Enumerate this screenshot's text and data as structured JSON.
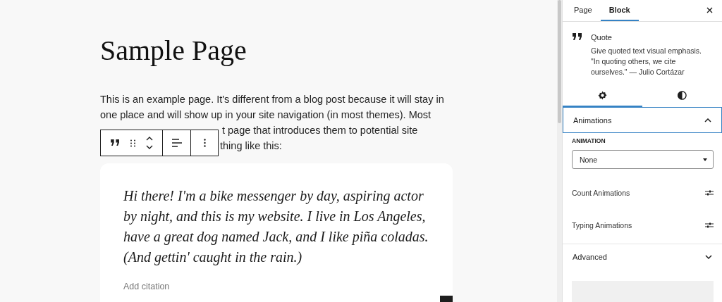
{
  "editor": {
    "title": "Sample Page",
    "paragraph_lines": [
      "This is an example page. It's different from a blog post because it will stay in",
      "one place and will show up in your site navigation (in most themes). Most",
      "t page that introduces them to potential site",
      "thing like this:"
    ],
    "quote": {
      "text": "Hi there! I'm a bike messenger by day, aspiring actor by night, and this is my website. I live in Los Angeles, have a great dog named Jack, and I like piña coladas. (And gettin' caught in the rain.)",
      "citation_placeholder": "Add citation"
    }
  },
  "sidebar": {
    "tabs": [
      {
        "label": "Page",
        "selected": false
      },
      {
        "label": "Block",
        "selected": true
      }
    ],
    "block_card": {
      "title": "Quote",
      "description": "Give quoted text visual emphasis. \"In quoting others, we cite ourselves.\" — Julio Cortázar"
    },
    "icon_tabs": [
      {
        "kind": "settings",
        "selected": true
      },
      {
        "kind": "styles",
        "selected": false
      }
    ],
    "panels": [
      {
        "title": "Animations",
        "expanded": true,
        "field_label": "ANIMATION",
        "select_value": "None",
        "items": [
          "Count Animations",
          "Typing Animations"
        ]
      },
      {
        "title": "Advanced",
        "expanded": false
      }
    ]
  }
}
